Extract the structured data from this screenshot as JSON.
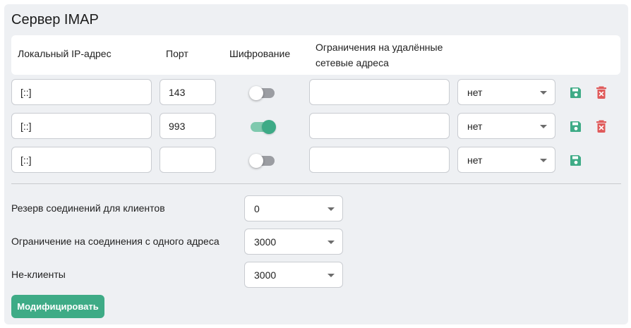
{
  "title": "Сервер IMAP",
  "colors": {
    "accent": "#3eab86",
    "delete": "#e05a5a",
    "panel": "#eef0f3"
  },
  "table": {
    "headers": {
      "local_ip": "Локальный IP-адрес",
      "port": "Порт",
      "encryption": "Шифрование",
      "restrictions": "Ограничения на удалённые сетевые адреса"
    },
    "rows": [
      {
        "ip": "[::]",
        "port": "143",
        "encryption": false,
        "restriction": "",
        "mode": "нет",
        "deletable": true
      },
      {
        "ip": "[::]",
        "port": "993",
        "encryption": true,
        "restriction": "",
        "mode": "нет",
        "deletable": true
      },
      {
        "ip": "[::]",
        "port": "",
        "encryption": false,
        "restriction": "",
        "mode": "нет",
        "deletable": false
      }
    ],
    "icons": {
      "save": "floppy-disk-icon",
      "delete": "trash-icon"
    }
  },
  "settings": [
    {
      "label": "Резерв соединений для клиентов",
      "value": "0"
    },
    {
      "label": "Ограничение на соединения с одного адреса",
      "value": "3000"
    },
    {
      "label": "Не-клиенты",
      "value": "3000"
    }
  ],
  "submit_label": "Модифицировать"
}
